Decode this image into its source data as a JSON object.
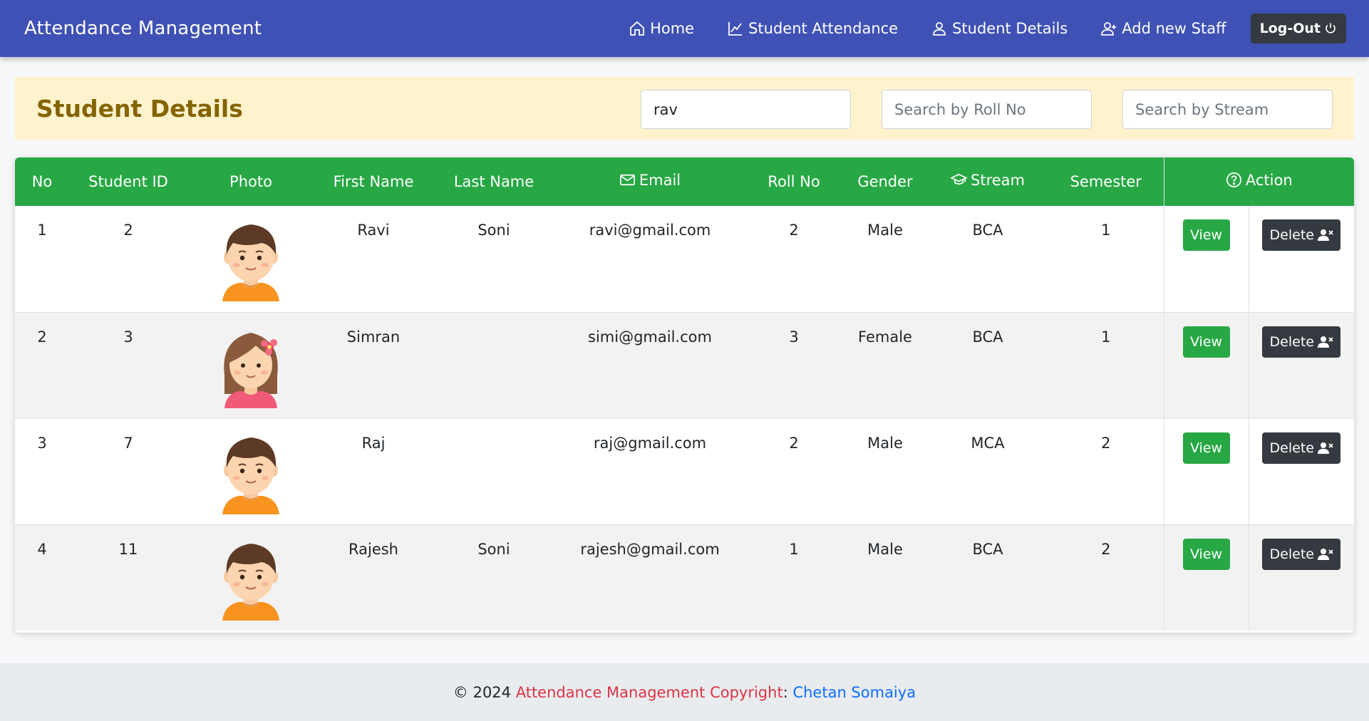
{
  "nav": {
    "brand": "Attendance Management",
    "links": [
      {
        "label": "Home",
        "icon": "house-icon"
      },
      {
        "label": "Student Attendance",
        "icon": "chart-line-icon"
      },
      {
        "label": "Student Details",
        "icon": "person-icon"
      },
      {
        "label": "Add new Staff",
        "icon": "person-plus-icon"
      }
    ],
    "logout_label": "Log-Out",
    "color": "#3f51b5"
  },
  "header": {
    "title": "Student Details",
    "search_name_value": "rav",
    "search_roll_placeholder": "Search by Roll No",
    "search_stream_placeholder": "Search by Stream",
    "color": "#fff3cd"
  },
  "table": {
    "columns": [
      "No",
      "Student ID",
      "Photo",
      "First Name",
      "Last Name",
      "Email",
      "Roll No",
      "Gender",
      "Stream",
      "Semester",
      "Action"
    ],
    "header_color": "#28a745",
    "view_label": "View",
    "delete_label": "Delete",
    "rows": [
      {
        "no": "1",
        "id": "2",
        "avatar": "boy-avatar",
        "first": "Ravi",
        "last": "Soni",
        "email": "ravi@gmail.com",
        "roll": "2",
        "gender": "Male",
        "stream": "BCA",
        "semester": "1"
      },
      {
        "no": "2",
        "id": "3",
        "avatar": "girl-avatar",
        "first": "Simran",
        "last": "",
        "email": "simi@gmail.com",
        "roll": "3",
        "gender": "Female",
        "stream": "BCA",
        "semester": "1"
      },
      {
        "no": "3",
        "id": "7",
        "avatar": "boy-avatar",
        "first": "Raj",
        "last": "",
        "email": "raj@gmail.com",
        "roll": "2",
        "gender": "Male",
        "stream": "MCA",
        "semester": "2"
      },
      {
        "no": "4",
        "id": "11",
        "avatar": "boy-avatar",
        "first": "Rajesh",
        "last": "Soni",
        "email": "rajesh@gmail.com",
        "roll": "1",
        "gender": "Male",
        "stream": "BCA",
        "semester": "2"
      }
    ]
  },
  "footer": {
    "year": "© 2024",
    "app": "Attendance Management Copyright",
    "colon": ":",
    "author": "Chetan Somaiya"
  }
}
